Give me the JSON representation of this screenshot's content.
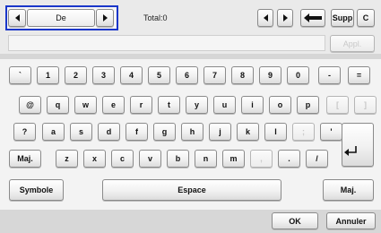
{
  "header": {
    "language_value": "De",
    "total_label": "Total:0",
    "supp_label": "Supp",
    "clear_label": "C"
  },
  "input": {
    "value": "",
    "apply_label": "Appl."
  },
  "keyboard": {
    "row1": [
      "`",
      "1",
      "2",
      "3",
      "4",
      "5",
      "6",
      "7",
      "8",
      "9",
      "0",
      "-",
      "="
    ],
    "row2": [
      "@",
      "q",
      "w",
      "e",
      "r",
      "t",
      "y",
      "u",
      "i",
      "o",
      "p",
      "[",
      "]"
    ],
    "row3": [
      "?",
      "a",
      "s",
      "d",
      "f",
      "g",
      "h",
      "j",
      "k",
      "l",
      ";",
      "'"
    ],
    "row4": [
      "z",
      "x",
      "c",
      "v",
      "b",
      "n",
      "m",
      ",",
      ".",
      "/"
    ],
    "maj_label": "Maj.",
    "symbol_label": "Symbole",
    "space_label": "Espace",
    "maj_right_label": "Maj."
  },
  "footer": {
    "ok_label": "OK",
    "cancel_label": "Annuler"
  },
  "icons": [
    "chevron-left-icon",
    "chevron-right-icon",
    "backspace-icon",
    "enter-icon"
  ],
  "colors": {
    "focus_border": "#1a36c9",
    "disabled_text": "#c8c8c8"
  }
}
